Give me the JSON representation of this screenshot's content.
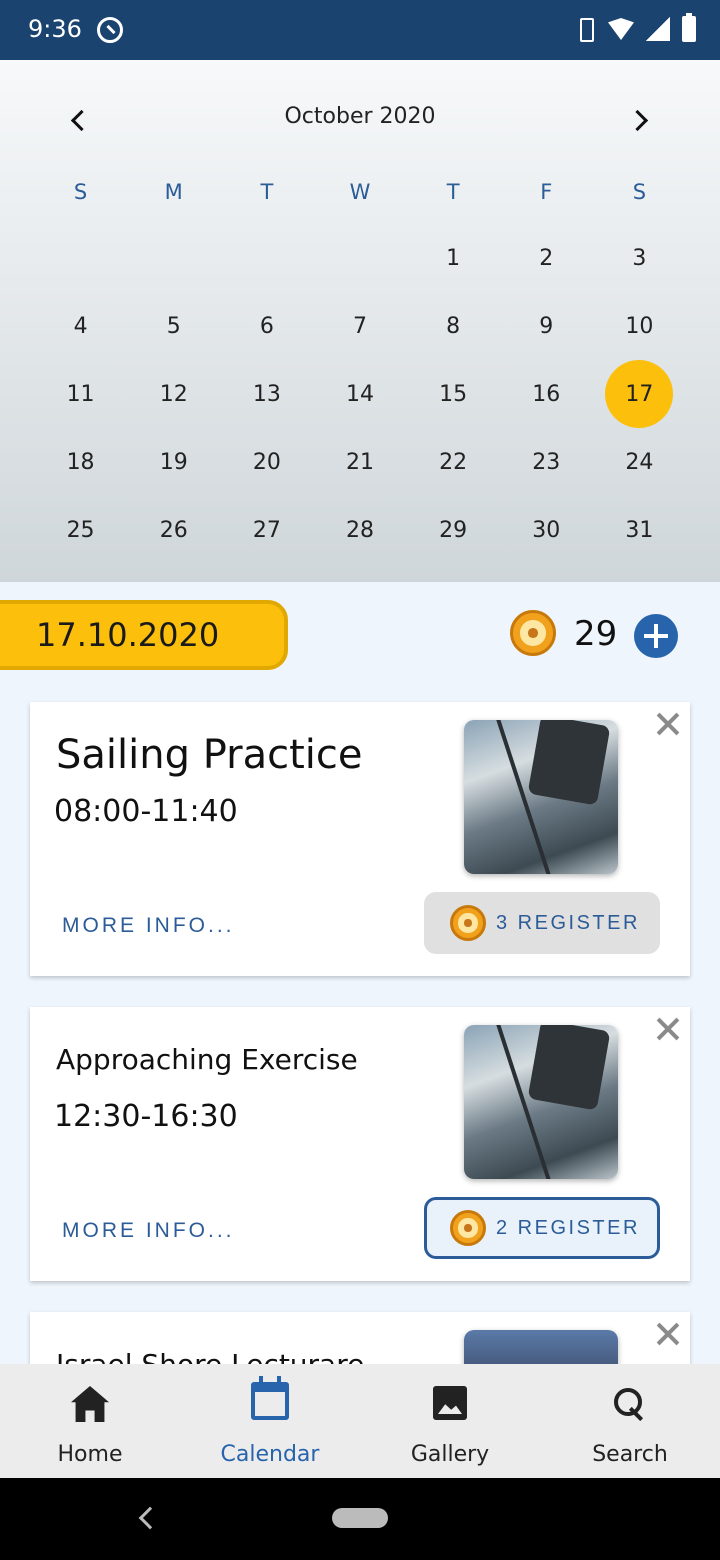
{
  "status_bar": {
    "time": "9:36"
  },
  "calendar": {
    "month_title": "October 2020",
    "weekdays": [
      "S",
      "M",
      "T",
      "W",
      "T",
      "F",
      "S"
    ],
    "days": [
      "",
      "",
      "",
      "",
      "1",
      "2",
      "3",
      "4",
      "5",
      "6",
      "7",
      "8",
      "9",
      "10",
      "11",
      "12",
      "13",
      "14",
      "15",
      "16",
      "17",
      "18",
      "19",
      "20",
      "21",
      "22",
      "23",
      "24",
      "25",
      "26",
      "27",
      "28",
      "29",
      "30",
      "31"
    ],
    "selected_day": "17"
  },
  "date_row": {
    "selected_date": "17.10.2020",
    "helm_count": "29"
  },
  "events": [
    {
      "title": "Sailing Practice",
      "time": "08:00-11:40",
      "more_info": "MORE INFO...",
      "register": "3 REGISTER"
    },
    {
      "title": "Approaching Exercise",
      "time": "12:30-16:30",
      "more_info": "MORE INFO...",
      "register": "2 REGISTER"
    },
    {
      "title": "Israel Shore Lecturare"
    }
  ],
  "bottom_nav": {
    "items": [
      {
        "label": "Home",
        "icon": "home-icon"
      },
      {
        "label": "Calendar",
        "icon": "calendar-icon"
      },
      {
        "label": "Gallery",
        "icon": "image-icon"
      },
      {
        "label": "Search",
        "icon": "search-icon"
      }
    ],
    "active": "Calendar"
  },
  "colors": {
    "status_bar": "#1b4370",
    "accent_yellow": "#fbbf0c",
    "primary_blue": "#2864ac"
  }
}
